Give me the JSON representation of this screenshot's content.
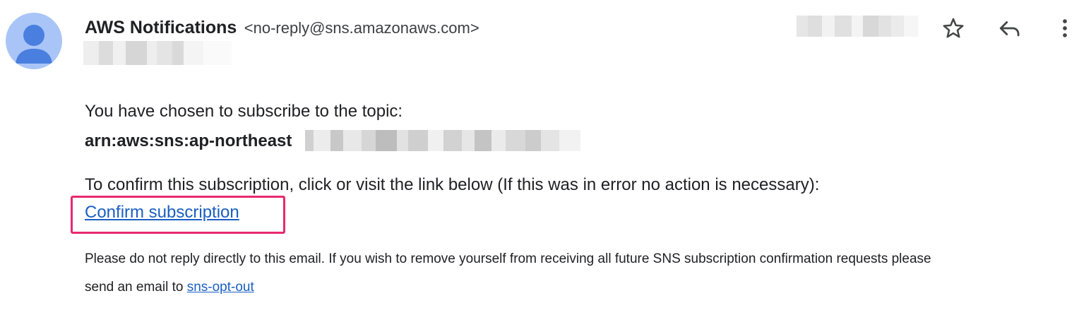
{
  "sender": {
    "name": "AWS Notifications",
    "email": "<no-reply@sns.amazonaws.com>"
  },
  "icons": {
    "avatar": "person-avatar-icon",
    "star": "star-icon",
    "reply": "reply-icon",
    "more": "more-vert-icon"
  },
  "body": {
    "line1": "You have chosen to subscribe to the topic:",
    "arn_visible": "arn:aws:sns:ap-northeast",
    "line3": "To confirm this subscription, click or visit the link below (If this was in error no action is necessary):",
    "confirm_link": "Confirm subscription",
    "footer_line1": "Please do not reply directly to this email. If you wish to remove yourself from receiving all future SNS subscription confirmation requests please",
    "footer_line2_prefix": "send an email to",
    "optout_link": "sns-opt-out"
  },
  "colors": {
    "link": "#1a5fc2",
    "highlight_border": "#e8296f",
    "avatar_bg": "#a9c5f7",
    "avatar_fg": "#4a7fe0"
  }
}
